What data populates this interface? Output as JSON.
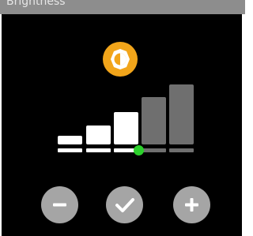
{
  "header": {
    "title": "Brightness"
  },
  "brightness": {
    "icon": "brightness-icon",
    "accent_color": "#f2a51a",
    "levels_total": 5,
    "level_current": 3,
    "slider_color": "#2bd02b"
  },
  "controls": {
    "decrease_icon": "minus-icon",
    "confirm_icon": "check-icon",
    "increase_icon": "plus-icon"
  }
}
